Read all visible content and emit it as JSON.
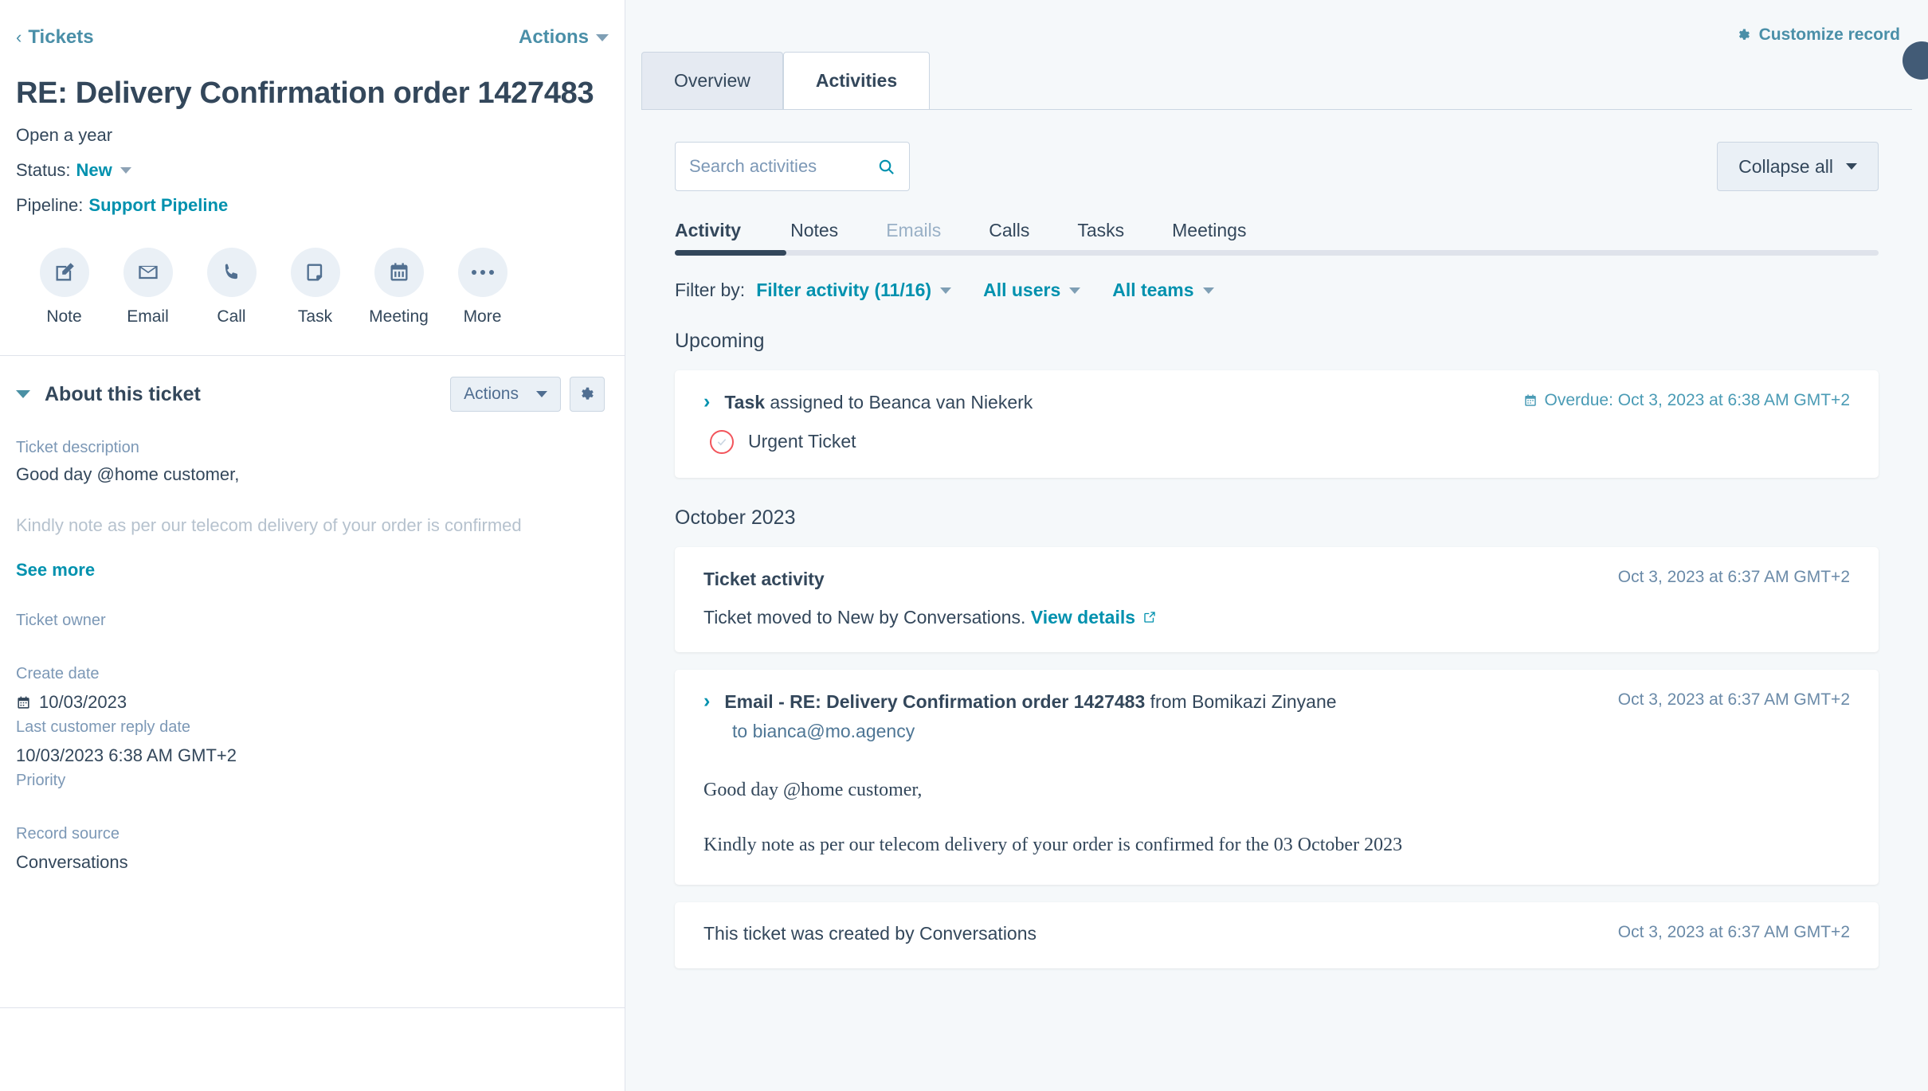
{
  "sidebar": {
    "back_label": "Tickets",
    "actions_label": "Actions",
    "title": "RE: Delivery Confirmation order 1427483",
    "open_status": "Open a year",
    "status_label": "Status:",
    "status_value": "New",
    "pipeline_label": "Pipeline:",
    "pipeline_value": "Support Pipeline",
    "quick_actions": [
      {
        "label": "Note",
        "icon": "note-icon"
      },
      {
        "label": "Email",
        "icon": "email-icon"
      },
      {
        "label": "Call",
        "icon": "call-icon"
      },
      {
        "label": "Task",
        "icon": "task-icon"
      },
      {
        "label": "Meeting",
        "icon": "meeting-icon"
      },
      {
        "label": "More",
        "icon": "more-icon"
      }
    ],
    "about_title": "About this ticket",
    "about_actions_label": "Actions",
    "fields": {
      "description_label": "Ticket description",
      "description_value": "Good day @home customer,",
      "description_faded": "Kindly note as per our telecom delivery of your order is confirmed",
      "see_more": "See more",
      "owner_label": "Ticket owner",
      "owner_value": "",
      "create_date_label": "Create date",
      "create_date_value": "10/03/2023",
      "last_reply_label": "Last customer reply date",
      "last_reply_value": "10/03/2023 6:38 AM GMT+2",
      "priority_label": "Priority",
      "priority_value": "",
      "record_source_label": "Record source",
      "record_source_value": "Conversations"
    }
  },
  "main": {
    "customize_label": "Customize record",
    "tabs": [
      {
        "label": "Overview",
        "active": false
      },
      {
        "label": "Activities",
        "active": true
      }
    ],
    "search": {
      "placeholder": "Search activities",
      "value": ""
    },
    "collapse_label": "Collapse all",
    "subtabs": [
      {
        "label": "Activity",
        "state": "active"
      },
      {
        "label": "Notes",
        "state": "normal"
      },
      {
        "label": "Emails",
        "state": "dim"
      },
      {
        "label": "Calls",
        "state": "normal"
      },
      {
        "label": "Tasks",
        "state": "normal"
      },
      {
        "label": "Meetings",
        "state": "normal"
      }
    ],
    "filter": {
      "label": "Filter by:",
      "activity": "Filter activity (11/16)",
      "users": "All users",
      "teams": "All teams"
    },
    "sections": {
      "upcoming": "Upcoming",
      "october": "October 2023"
    },
    "task_card": {
      "title_bold": "Task",
      "title_rest": " assigned to Beanca van Niekerk",
      "time": "Overdue: Oct 3, 2023 at 6:38 AM GMT+2",
      "task_name": "Urgent Ticket"
    },
    "ticket_activity_card": {
      "title": "Ticket activity",
      "time": "Oct 3, 2023 at 6:37 AM GMT+2",
      "body": "Ticket moved to New by Conversations.",
      "link": "View details"
    },
    "email_card": {
      "title_bold": "Email - RE: Delivery Confirmation order 1427483",
      "title_rest": " from Bomikazi Zinyane",
      "to_line": "to bianca@mo.agency",
      "time": "Oct 3, 2023 at 6:37 AM GMT+2",
      "body_line1": "Good day @home customer,",
      "body_line2": "Kindly note as per our telecom delivery of your order is confirmed for the 03 October 2023"
    },
    "created_card": {
      "text": "This ticket was created by Conversations",
      "time": "Oct 3, 2023 at 6:37 AM GMT+2"
    }
  }
}
